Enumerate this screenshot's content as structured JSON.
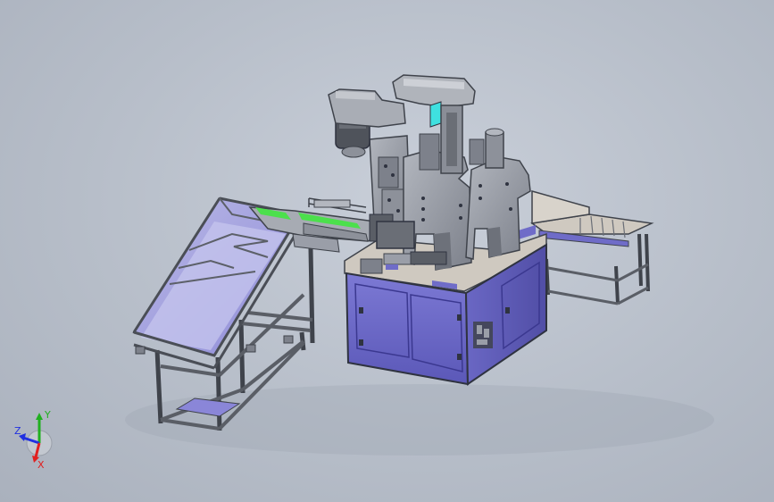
{
  "viewport": {
    "background_colors": [
      "#c9cfd9",
      "#aab1bd"
    ]
  },
  "model": {
    "colors": {
      "frame": "#8f939c",
      "frame_dark": "#3f434b",
      "panel_blue": "#8a86d8",
      "cabinet_blue": "#6f6cc8",
      "cabinet_dark": "#4f4ca8",
      "press_gray": "#9a9ea8",
      "accent_green": "#4ce04c",
      "accent_cyan": "#3fe0e0",
      "plate_beige": "#cfc9c0"
    }
  },
  "triad": {
    "x_label": "X",
    "y_label": "Y",
    "z_label": "Z",
    "x_color": "#e02020",
    "y_color": "#20b020",
    "z_color": "#2030e0"
  }
}
